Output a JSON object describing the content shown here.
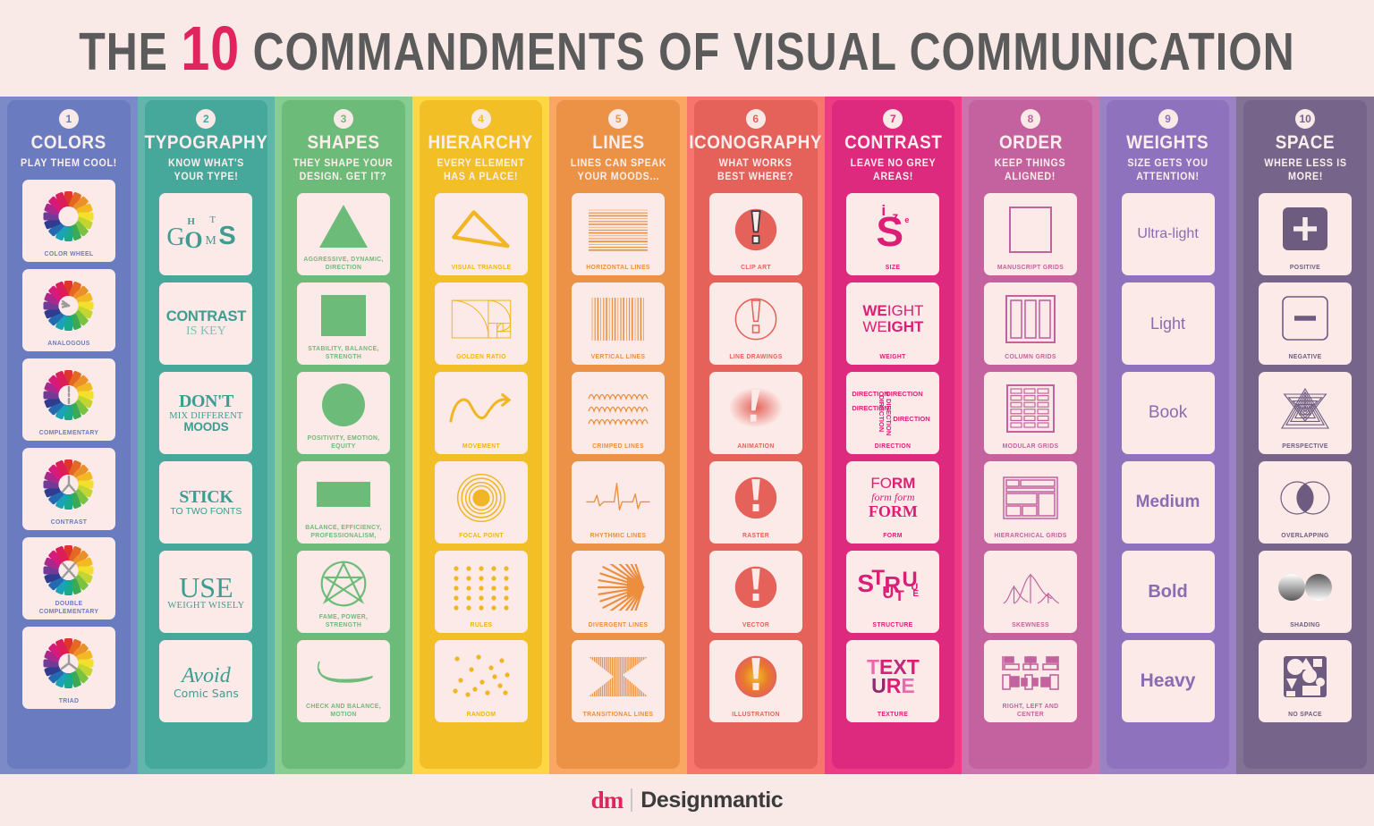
{
  "header": {
    "title_part1": "THE",
    "title_number": "10",
    "title_part2": "COMMANDMENTS OF VISUAL COMMUNICATION"
  },
  "footer": {
    "logo_mark": "dm",
    "brand_name": "Designmantic"
  },
  "columns": [
    {
      "number": "1",
      "title": "COLORS",
      "subtitle": "PLAY THEM COOL!",
      "bg": "#6b7cbf",
      "accent": "#6b7cbf",
      "tiles": [
        {
          "caption": "COLOR WHEEL",
          "art": "wheel-plain"
        },
        {
          "caption": "ANALOGOUS",
          "art": "wheel-analogous"
        },
        {
          "caption": "COMPLEMENTARY",
          "art": "wheel-complementary"
        },
        {
          "caption": "CONTRAST",
          "art": "wheel-contrast"
        },
        {
          "caption": "DOUBLE COMPLEMENTARY",
          "art": "wheel-double"
        },
        {
          "caption": "TRIAD",
          "art": "wheel-triad"
        }
      ]
    },
    {
      "number": "2",
      "title": "TYPOGRAPHY",
      "subtitle": "KNOW WHAT'S YOUR TYPE!",
      "bg": "#46a79b",
      "accent": "#3f9c90",
      "tiles": [
        {
          "caption": "",
          "art": "typo-ghosts",
          "words": [
            "G",
            "H",
            "O",
            "T",
            "M",
            "S"
          ]
        },
        {
          "caption": "",
          "art": "typo-contrast",
          "line1": "CONTRAST",
          "line2": "IS KEY"
        },
        {
          "caption": "",
          "art": "typo-dont",
          "line1": "DON'T",
          "line2": "MIX DIFFERENT",
          "line3": "MOODS"
        },
        {
          "caption": "",
          "art": "typo-stick",
          "line1": "STICK",
          "line2": "TO TWO FONTS"
        },
        {
          "caption": "",
          "art": "typo-use",
          "line1": "USE",
          "line2": "WEIGHT WISELY"
        },
        {
          "caption": "",
          "art": "typo-avoid",
          "line1": "Avoid",
          "line2": "Comic Sans"
        }
      ]
    },
    {
      "number": "3",
      "title": "SHAPES",
      "subtitle": "THEY SHAPE YOUR DESIGN. GET IT?",
      "bg": "#6dbb78",
      "accent": "#6dbb78",
      "tiles": [
        {
          "caption": "AGGRESSIVE, DYNAMIC, DIRECTION",
          "art": "shape-triangle"
        },
        {
          "caption": "STABILITY, BALANCE, STRENGTH",
          "art": "shape-square"
        },
        {
          "caption": "POSITIVITY, EMOTION, EQUITY",
          "art": "shape-circle"
        },
        {
          "caption": "BALANCE, EFFICIENCY, PROFESSIONALISM,",
          "art": "shape-rect"
        },
        {
          "caption": "FAME, POWER, STRENGTH",
          "art": "shape-pentagram"
        },
        {
          "caption": "CHECK AND BALANCE, MOTION",
          "art": "shape-swoosh"
        }
      ]
    },
    {
      "number": "4",
      "title": "HIERARCHY",
      "subtitle": "EVERY ELEMENT HAS A PLACE!",
      "bg": "#f6c01e",
      "accent": "#f0b400",
      "tiles": [
        {
          "caption": "VISUAL TRIANGLE",
          "art": "hier-triangle"
        },
        {
          "caption": "GOLDEN RATIO",
          "art": "hier-golden"
        },
        {
          "caption": "MOVEMENT",
          "art": "hier-movement"
        },
        {
          "caption": "FOCAL POINT",
          "art": "hier-focal"
        },
        {
          "caption": "RULES",
          "art": "hier-rules"
        },
        {
          "caption": "RANDOM",
          "art": "hier-random"
        }
      ]
    },
    {
      "number": "5",
      "title": "LINES",
      "subtitle": "LINES CAN SPEAK YOUR MOODS...",
      "bg": "#ef9247",
      "accent": "#ef8f3e",
      "tiles": [
        {
          "caption": "HORIZONTAL LINES",
          "art": "line-horizontal"
        },
        {
          "caption": "VERTICAL LINES",
          "art": "line-vertical"
        },
        {
          "caption": "CRIMPED LINES",
          "art": "line-crimped"
        },
        {
          "caption": "RHYTHMIC LINES",
          "art": "line-rhythmic"
        },
        {
          "caption": "DIVERGENT LINES",
          "art": "line-divergent"
        },
        {
          "caption": "TRANSITIONAL LINES",
          "art": "line-transitional"
        }
      ]
    },
    {
      "number": "6",
      "title": "ICONOGRAPHY",
      "subtitle": "WHAT WORKS BEST WHERE?",
      "bg": "#f4625a",
      "accent": "#f4625a",
      "tiles": [
        {
          "caption": "CLIP ART",
          "art": "icon-clipart"
        },
        {
          "caption": "LINE DRAWINGS",
          "art": "icon-linedrawing"
        },
        {
          "caption": "ANIMATION",
          "art": "icon-animation"
        },
        {
          "caption": "RASTER",
          "art": "icon-raster"
        },
        {
          "caption": "VECTOR",
          "art": "icon-vector"
        },
        {
          "caption": "ILLUSTRATION",
          "art": "icon-illustration"
        }
      ]
    },
    {
      "number": "7",
      "title": "CONTRAST",
      "subtitle": "LEAVE NO GREY AREAS!",
      "bg": "#f22b7f",
      "accent": "#e91e78",
      "tiles": [
        {
          "caption": "SIZE",
          "art": "contrast-size",
          "words": [
            "i",
            "z",
            "e",
            "S"
          ]
        },
        {
          "caption": "WEIGHT",
          "art": "contrast-weight",
          "line1": "WEIGHT",
          "line2": "WEIGHT"
        },
        {
          "caption": "DIRECTION",
          "art": "contrast-direction",
          "word": "DIRECTION"
        },
        {
          "caption": "FORM",
          "art": "contrast-form",
          "line1": "FORM",
          "line2": "form form",
          "line3": "FORM"
        },
        {
          "caption": "STRUCTURE",
          "art": "contrast-structure",
          "word": "STRUCTURE"
        },
        {
          "caption": "TEXTURE",
          "art": "contrast-texture",
          "line1": "TEXT",
          "line2": "URE"
        }
      ]
    },
    {
      "number": "8",
      "title": "ORDER",
      "subtitle": "KEEP THINGS ALIGNED!",
      "bg": "#c4629f",
      "accent": "#c4629f",
      "tiles": [
        {
          "caption": "MANUSCRIPT GRIDS",
          "art": "grid-manuscript"
        },
        {
          "caption": "COLUMN GRIDS",
          "art": "grid-column"
        },
        {
          "caption": "MODULAR GRIDS",
          "art": "grid-modular"
        },
        {
          "caption": "HIERARCHICAL GRIDS",
          "art": "grid-hierarchical"
        },
        {
          "caption": "SKEWNESS",
          "art": "grid-skewness"
        },
        {
          "caption": "RIGHT, LEFT AND CENTER",
          "art": "grid-alignment"
        }
      ]
    },
    {
      "number": "9",
      "title": "WEIGHTS",
      "subtitle": "SIZE GETS YOU ATTENTION!",
      "bg": "#8e72bd",
      "accent": "#8b6bb1",
      "tiles": [
        {
          "caption": "",
          "art": "weight-word",
          "word": "Ultra-light",
          "weight": 200,
          "size": 16
        },
        {
          "caption": "",
          "art": "weight-word",
          "word": "Light",
          "weight": 300,
          "size": 18
        },
        {
          "caption": "",
          "art": "weight-word",
          "word": "Book",
          "weight": 400,
          "size": 19
        },
        {
          "caption": "",
          "art": "weight-word",
          "word": "Medium",
          "weight": 600,
          "size": 19
        },
        {
          "caption": "",
          "art": "weight-word",
          "word": "Bold",
          "weight": 700,
          "size": 20
        },
        {
          "caption": "",
          "art": "weight-word",
          "word": "Heavy",
          "weight": 800,
          "size": 21
        }
      ]
    },
    {
      "number": "10",
      "title": "SPACE",
      "subtitle": "WHERE LESS IS MORE!",
      "bg": "#77648a",
      "accent": "#6e5c80",
      "tiles": [
        {
          "caption": "POSITIVE",
          "art": "space-positive"
        },
        {
          "caption": "NEGATIVE",
          "art": "space-negative"
        },
        {
          "caption": "PERSPECTIVE",
          "art": "space-perspective"
        },
        {
          "caption": "OVERLAPPING",
          "art": "space-overlapping"
        },
        {
          "caption": "SHADING",
          "art": "space-shading"
        },
        {
          "caption": "NO SPACE",
          "art": "space-nospace"
        }
      ]
    }
  ],
  "wheel_colors": [
    "#e8362a",
    "#ef6724",
    "#f2922a",
    "#f6b91f",
    "#f2e023",
    "#c2d530",
    "#7cc242",
    "#3aa957",
    "#18a98c",
    "#1aa2b8",
    "#2569b0",
    "#2f3c8f",
    "#6f3b96",
    "#a8288e",
    "#d7197c",
    "#e81e5a"
  ]
}
